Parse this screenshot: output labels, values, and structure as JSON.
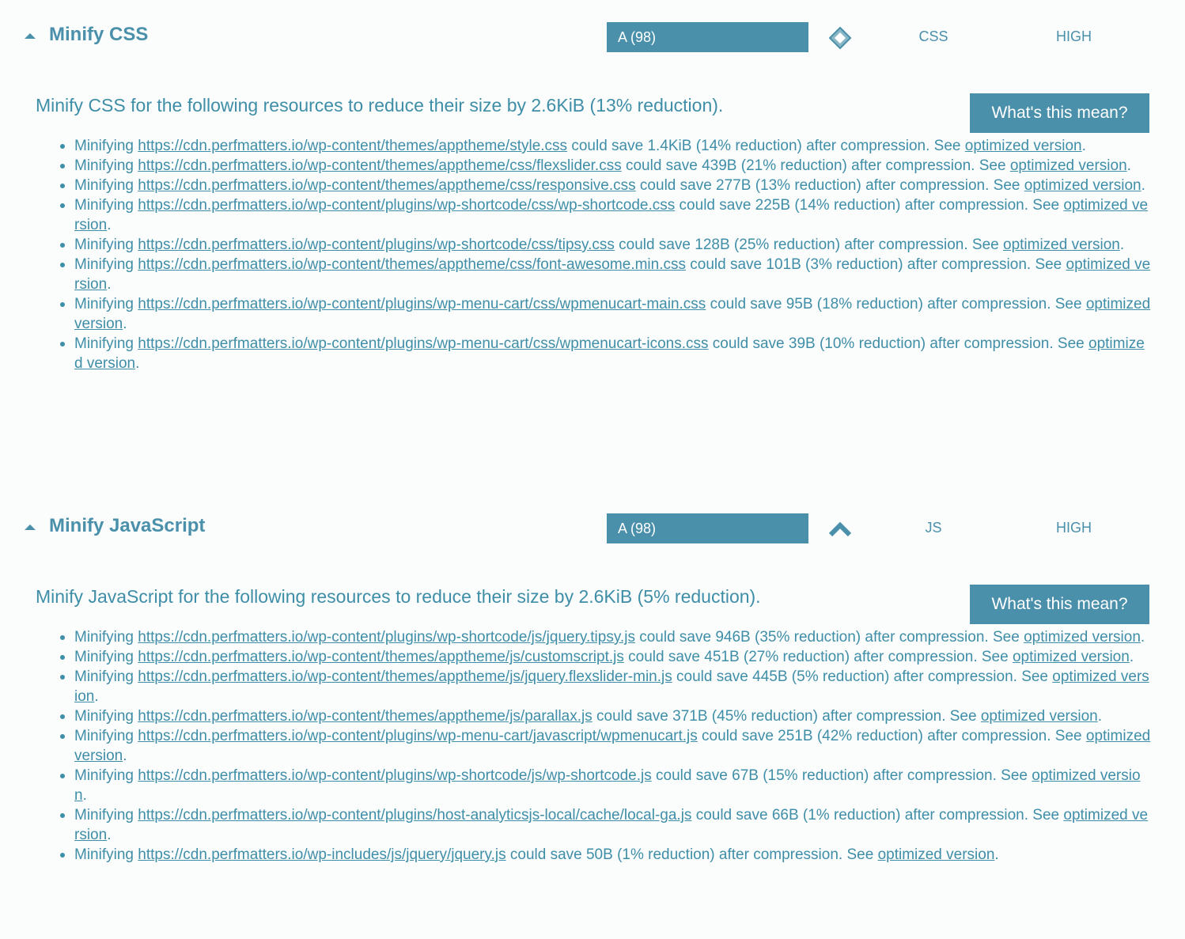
{
  "sections": [
    {
      "title": "Minify CSS",
      "grade": "A (98)",
      "trend_icon": "diamond-icon",
      "type": "CSS",
      "priority": "HIGH",
      "summary": "Minify CSS for the following resources to reduce their size by 2.6KiB (13% reduction).",
      "button_label": "What's this mean?",
      "items": [
        {
          "prefix": "Minifying ",
          "url": "https://cdn.perfmatters.io/wp-content/themes/apptheme/style.css",
          "middle": " could save 1.4KiB (14% reduction) after compression. See ",
          "link": "optimized version",
          "suffix": "."
        },
        {
          "prefix": "Minifying ",
          "url": "https://cdn.perfmatters.io/wp-content/themes/apptheme/css/flexslider.css",
          "middle": " could save 439B (21% reduction) after compression. See ",
          "link": "optimized version",
          "suffix": "."
        },
        {
          "prefix": "Minifying ",
          "url": "https://cdn.perfmatters.io/wp-content/themes/apptheme/css/responsive.css",
          "middle": " could save 277B (13% reduction) after compression. See ",
          "link": "optimized version",
          "suffix": "."
        },
        {
          "prefix": "Minifying ",
          "url": "https://cdn.perfmatters.io/wp-content/plugins/wp-shortcode/css/wp-shortcode.css",
          "middle": " could save 225B (14% reduction) after compression. See ",
          "link": "optimized version",
          "suffix": "."
        },
        {
          "prefix": "Minifying ",
          "url": "https://cdn.perfmatters.io/wp-content/plugins/wp-shortcode/css/tipsy.css",
          "middle": " could save 128B (25% reduction) after compression. See ",
          "link": "optimized version",
          "suffix": "."
        },
        {
          "prefix": "Minifying ",
          "url": "https://cdn.perfmatters.io/wp-content/themes/apptheme/css/font-awesome.min.css",
          "middle": " could save 101B (3% reduction) after compression. See ",
          "link": "optimized version",
          "suffix": "."
        },
        {
          "prefix": "Minifying ",
          "url": "https://cdn.perfmatters.io/wp-content/plugins/wp-menu-cart/css/wpmenucart-main.css",
          "middle": " could save 95B (18% reduction) after compression. See ",
          "link": "optimized version",
          "suffix": "."
        },
        {
          "prefix": "Minifying ",
          "url": "https://cdn.perfmatters.io/wp-content/plugins/wp-menu-cart/css/wpmenucart-icons.css",
          "middle": " could save 39B (10% reduction) after compression. See ",
          "link": "optimized version",
          "suffix": "."
        }
      ]
    },
    {
      "title": "Minify JavaScript",
      "grade": "A (98)",
      "trend_icon": "chevron-up-icon",
      "type": "JS",
      "priority": "HIGH",
      "summary": "Minify JavaScript for the following resources to reduce their size by 2.6KiB (5% reduction).",
      "button_label": "What's this mean?",
      "items": [
        {
          "prefix": "Minifying ",
          "url": "https://cdn.perfmatters.io/wp-content/plugins/wp-shortcode/js/jquery.tipsy.js",
          "middle": " could save 946B (35% reduction) after compression. See ",
          "link": "optimized version",
          "suffix": "."
        },
        {
          "prefix": "Minifying ",
          "url": "https://cdn.perfmatters.io/wp-content/themes/apptheme/js/customscript.js",
          "middle": " could save 451B (27% reduction) after compression. See ",
          "link": "optimized version",
          "suffix": "."
        },
        {
          "prefix": "Minifying ",
          "url": "https://cdn.perfmatters.io/wp-content/themes/apptheme/js/jquery.flexslider-min.js",
          "middle": " could save 445B (5% reduction) after compression. See ",
          "link": "optimized version",
          "suffix": "."
        },
        {
          "prefix": "Minifying ",
          "url": "https://cdn.perfmatters.io/wp-content/themes/apptheme/js/parallax.js",
          "middle": " could save 371B (45% reduction) after compression. See ",
          "link": "optimized version",
          "suffix": "."
        },
        {
          "prefix": "Minifying ",
          "url": "https://cdn.perfmatters.io/wp-content/plugins/wp-menu-cart/javascript/wpmenucart.js",
          "middle": " could save 251B (42% reduction) after compression. See ",
          "link": "optimized version",
          "suffix": "."
        },
        {
          "prefix": "Minifying ",
          "url": "https://cdn.perfmatters.io/wp-content/plugins/wp-shortcode/js/wp-shortcode.js",
          "middle": " could save 67B (15% reduction) after compression. See ",
          "link": "optimized version",
          "suffix": "."
        },
        {
          "prefix": "Minifying ",
          "url": "https://cdn.perfmatters.io/wp-content/plugins/host-analyticsjs-local/cache/local-ga.js",
          "middle": " could save 66B (1% reduction) after compression. See ",
          "link": "optimized version",
          "suffix": "."
        },
        {
          "prefix": "Minifying ",
          "url": "https://cdn.perfmatters.io/wp-includes/js/jquery/jquery.js",
          "middle": " could save 50B (1% reduction) after compression. See ",
          "link": "optimized version",
          "suffix": "."
        }
      ]
    }
  ],
  "colors": {
    "accent": "#4a90ab",
    "text": "#3f8ea8",
    "background": "#fbfcfc"
  }
}
